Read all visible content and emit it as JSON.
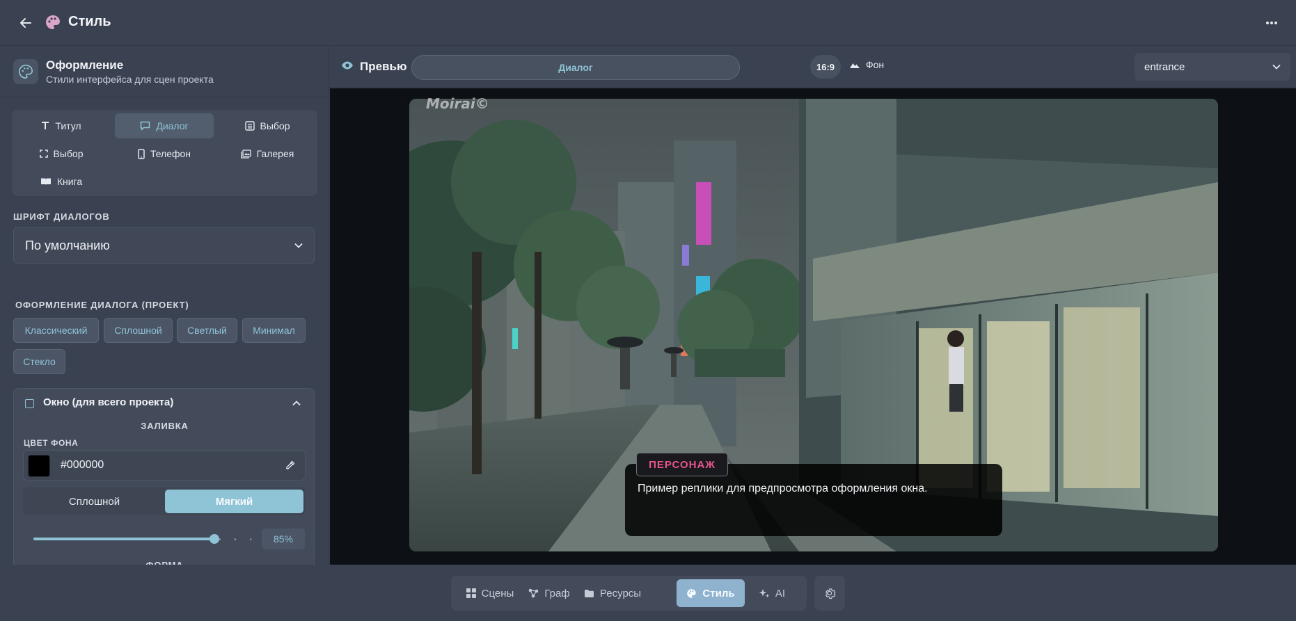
{
  "header": {
    "title": "Стиль"
  },
  "panel": {
    "title": "Оформление",
    "subtitle": "Стили интерфейса для сцен проекта",
    "tabs": [
      {
        "label": "Титул",
        "icon": "text-icon"
      },
      {
        "label": "Диалог",
        "icon": "chat-icon"
      },
      {
        "label": "Выбор",
        "icon": "list-icon"
      },
      {
        "label": "Выбор",
        "icon": "focus-icon"
      },
      {
        "label": "Телефон",
        "icon": "phone-icon"
      },
      {
        "label": "Галерея",
        "icon": "gallery-icon"
      },
      {
        "label": "Книга",
        "icon": "book-icon"
      }
    ],
    "active_tab": "Диалог",
    "font_section_label": "ШРИФТ ДИАЛОГОВ",
    "font_value": "По умолчанию",
    "style_section_label": "ОФОРМЛЕНИЕ ДИАЛОГА (ПРОЕКТ)",
    "style_presets": [
      "Классический",
      "Сплошной",
      "Светлый",
      "Минимал",
      "Стекло"
    ],
    "window_card": {
      "title": "Окно (для всего проекта)",
      "fill_label": "ЗАЛИВКА",
      "bg_color_label": "ЦВЕТ ФОНА",
      "bg_color": "#000000",
      "modes": [
        "Сплошной",
        "Мягкий"
      ],
      "active_mode": "Мягкий",
      "opacity": "85%",
      "opacity_fraction": 0.85,
      "next_label": "ФОРМА"
    }
  },
  "preview": {
    "label": "Превью",
    "mode": "Диалог",
    "ratio": "16:9",
    "background_toggle": "Фон",
    "scene": "entrance",
    "watermark": "Moirai©",
    "speaker": "ПЕРСОНАЖ",
    "line": "Пример реплики для предпросмотра оформления окна."
  },
  "nav": {
    "items": [
      {
        "label": "Сцены",
        "icon": "grid-icon"
      },
      {
        "label": "Граф",
        "icon": "graph-icon"
      },
      {
        "label": "Ресурсы",
        "icon": "folder-icon"
      },
      {
        "label": "Стиль",
        "icon": "palette-icon"
      },
      {
        "label": "AI",
        "icon": "sparkle-icon"
      }
    ],
    "active": "Стиль"
  },
  "colors": {
    "accent": "#8fc3d6",
    "speaker": "#e7558f",
    "background": "#3a4150"
  }
}
